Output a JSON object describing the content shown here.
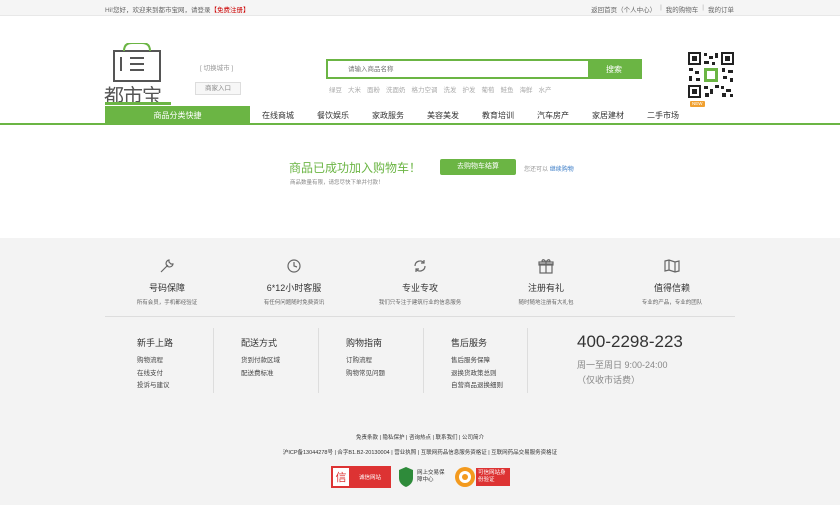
{
  "topbar": {
    "welcome": "Hi!您好，欢迎来到都市宝网，请登录",
    "register": "【免费注册】",
    "links": [
      "返回首页（个人中心）",
      "我的购物车",
      "我的订单"
    ]
  },
  "header": {
    "logo_text": "都市宝",
    "city_switch": "[ 切换城市 ]",
    "merchant_entry": "商家入口",
    "search_placeholder": "请输入商品名称",
    "search_button": "搜索",
    "hotwords": [
      "绿豆",
      "大米",
      "面粉",
      "洗面奶",
      "格力空调",
      "洗发",
      "护发",
      "葡萄",
      "鲑鱼",
      "海鲜",
      "水产"
    ]
  },
  "nav": {
    "category": "商品分类快捷",
    "items": [
      "在线商城",
      "餐饮娱乐",
      "家政服务",
      "美容美发",
      "教育培训",
      "汽车房产",
      "家居建材",
      "二手市场"
    ],
    "new_badge": "NEW"
  },
  "success": {
    "message": "商品已成功加入购物车！",
    "note": "商品数量有限，请您尽快下单并付款！",
    "button": "去购物车结算",
    "continue_prefix": "您还可以",
    "continue_link": "继续购物"
  },
  "services": [
    {
      "icon": "wrench-icon",
      "title": "号码保障",
      "desc": "所有会员，手机都经验证"
    },
    {
      "icon": "clock-icon",
      "title": "6*12小时客服",
      "desc": "有任何问题随时免费资讯"
    },
    {
      "icon": "refresh-icon",
      "title": "专业专攻",
      "desc": "我们只专注于建筑行业的信息服务"
    },
    {
      "icon": "gift-icon",
      "title": "注册有礼",
      "desc": "随时随地注册有大礼包"
    },
    {
      "icon": "map-icon",
      "title": "值得信赖",
      "desc": "专业的产品，专业的团队"
    }
  ],
  "help_columns": [
    {
      "title": "新手上路",
      "links": [
        "购物流程",
        "在线支付",
        "投诉与建议"
      ]
    },
    {
      "title": "配送方式",
      "links": [
        "货到付款区域",
        "配送费标准"
      ]
    },
    {
      "title": "购物指南",
      "links": [
        "订购流程",
        "购物常见问题"
      ]
    },
    {
      "title": "售后服务",
      "links": [
        "售后服务保障",
        "退换货政策总则",
        "自营商品退换细则"
      ]
    }
  ],
  "contact": {
    "phone": "400-2298-223",
    "hours": "周一至周日 9:00-24:00",
    "note": "（仅收市话费）"
  },
  "footer_links": [
    "免责条款",
    "隐私保护",
    "咨询热点",
    "联系我们",
    "公司简介"
  ],
  "icp": "沪ICP备13044278号 | 合字B1.B2-20130004 | 营业执照 | 互联网药品信息服务资格证 | 互联网药品交易服务资格证",
  "badges": [
    "诚信网站",
    "网上交易保障中心",
    "可信网站身份验证"
  ],
  "colors": {
    "accent": "#6bb544",
    "footer_bg": "#f3f3f3"
  }
}
